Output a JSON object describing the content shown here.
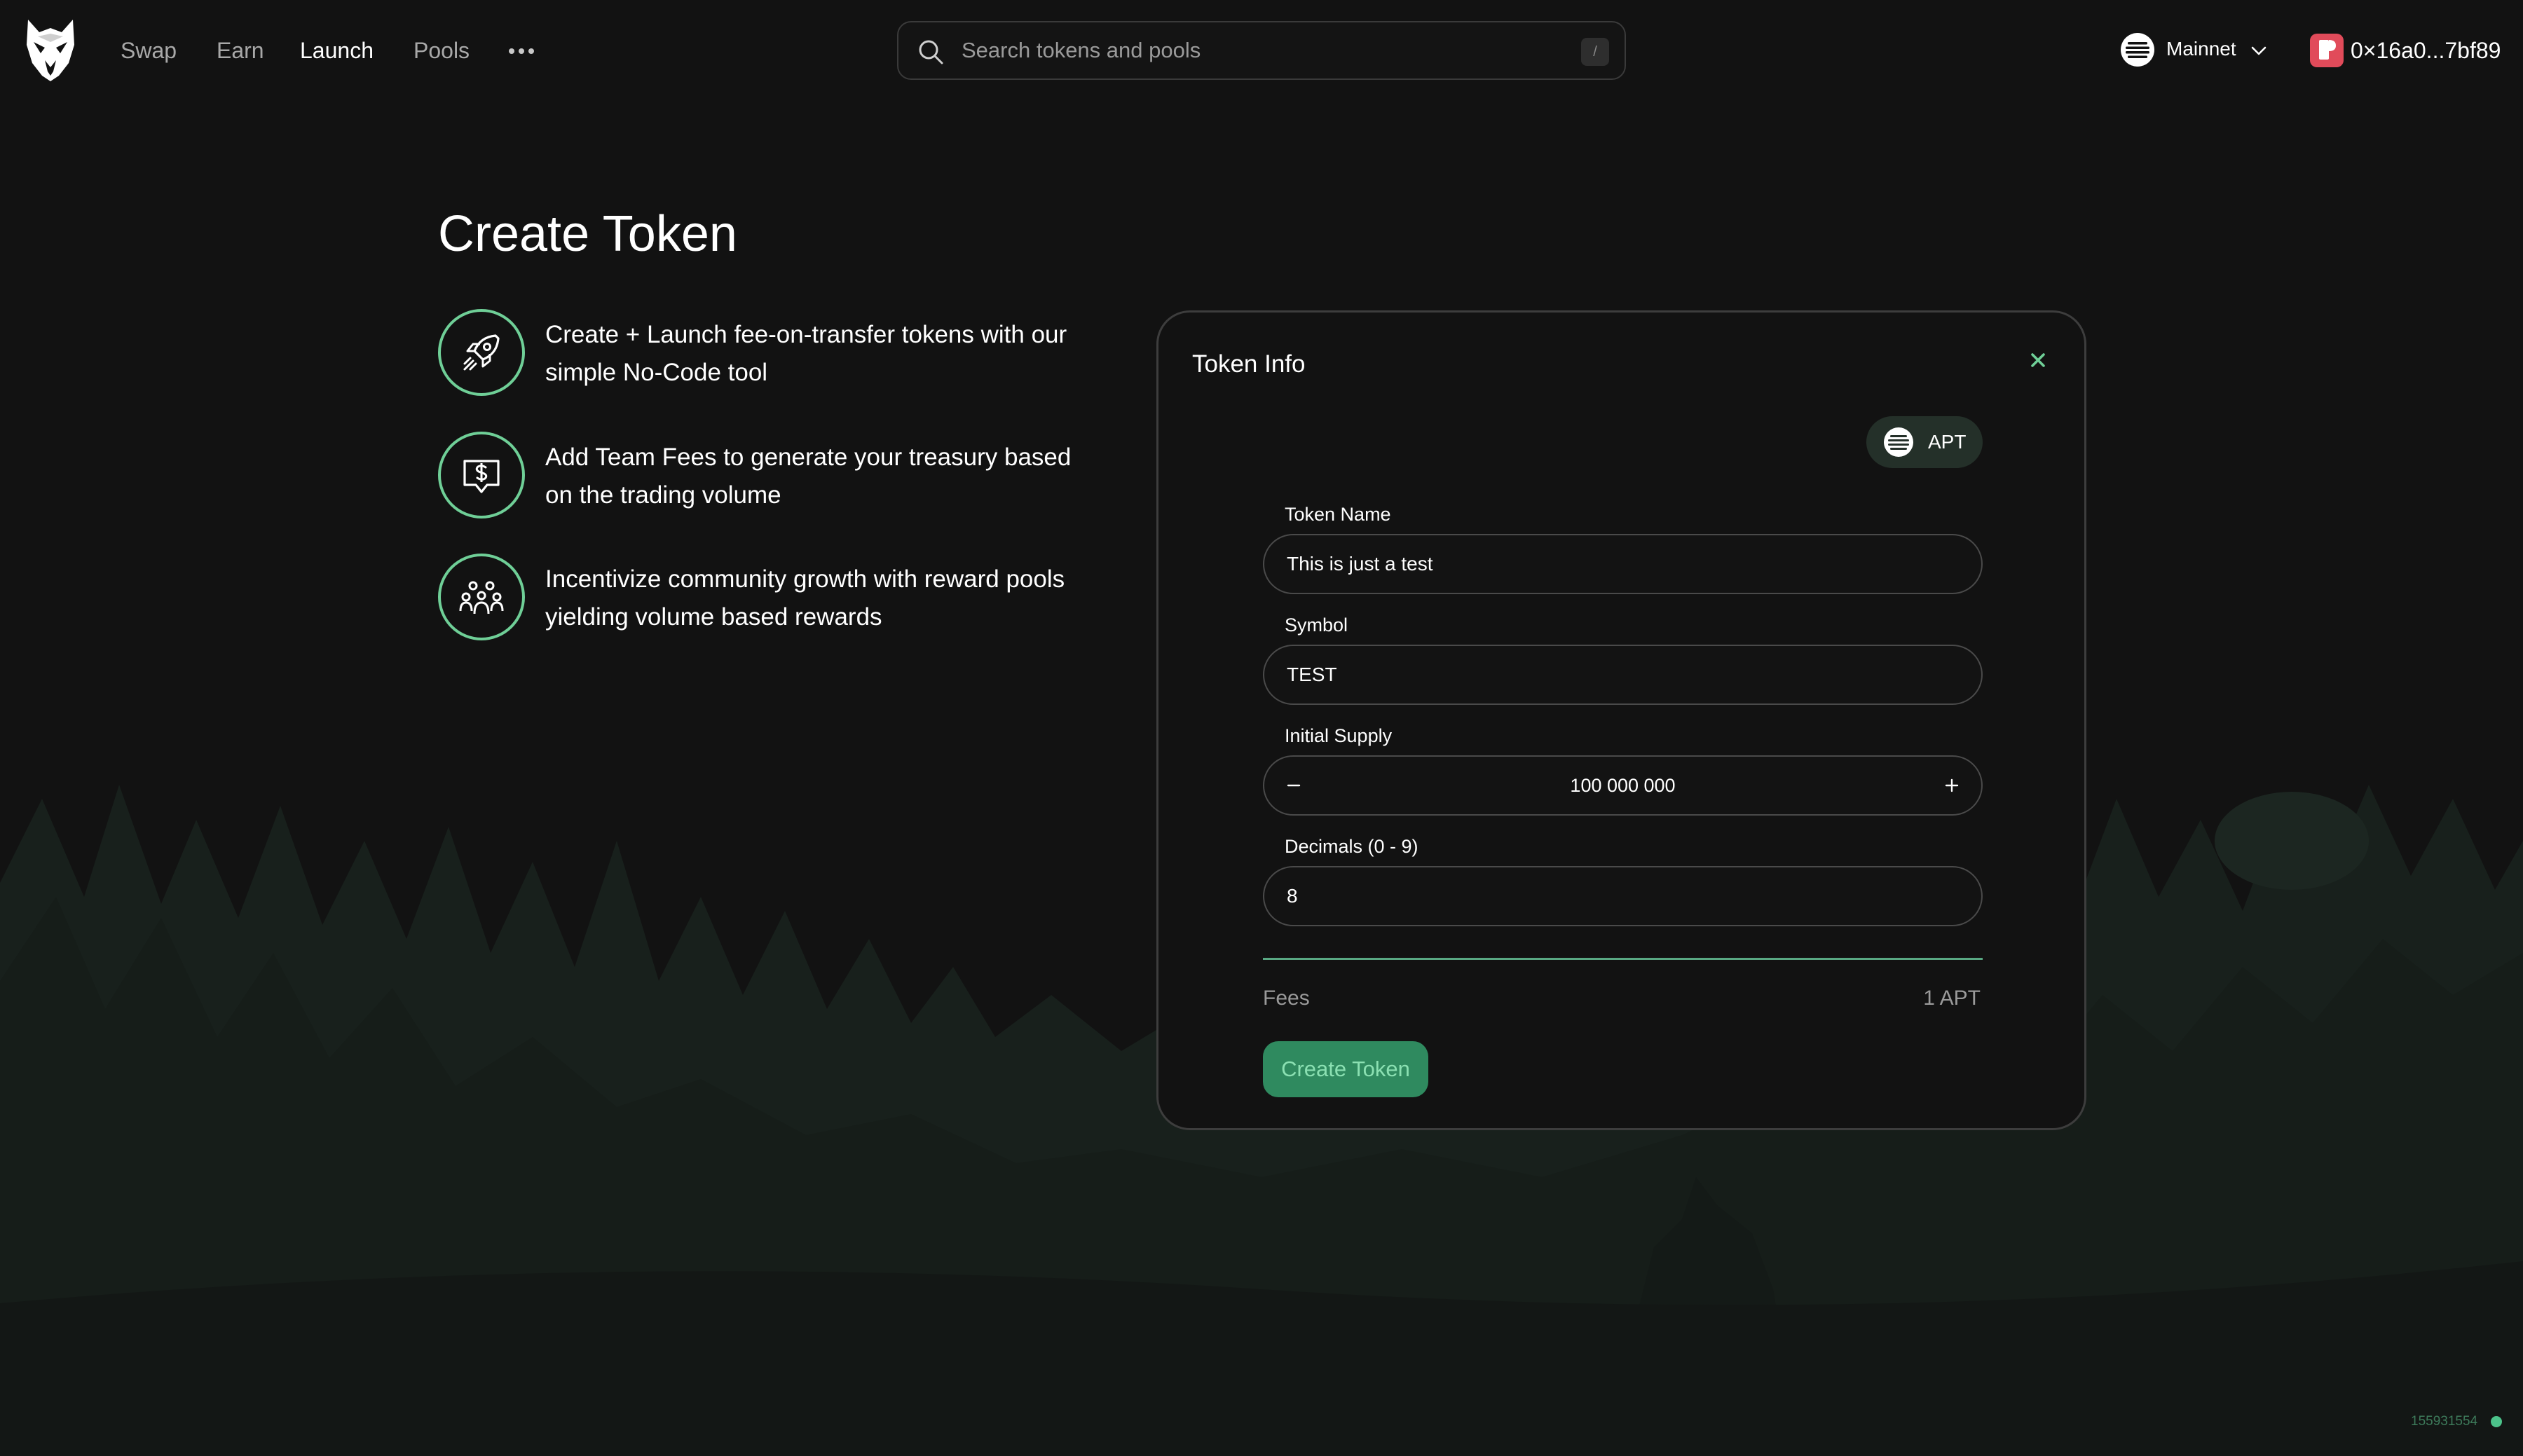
{
  "nav": {
    "links": [
      {
        "label": "Swap",
        "active": false
      },
      {
        "label": "Earn",
        "active": false
      },
      {
        "label": "Launch",
        "active": true
      },
      {
        "label": "Pools",
        "active": false
      }
    ],
    "more_icon": "more-horizontal-icon"
  },
  "search": {
    "placeholder": "Search tokens and pools",
    "shortcut": "/"
  },
  "network": {
    "label": "Mainnet",
    "icon": "aptos-icon"
  },
  "wallet": {
    "address": "0×16a0...7bf89",
    "icon": "petra-wallet-icon",
    "color": "#e14b5a"
  },
  "page": {
    "title": "Create Token",
    "features": [
      {
        "icon": "rocket-icon",
        "text": "Create + Launch fee-on-transfer tokens with our simple No-Code tool"
      },
      {
        "icon": "dollar-speech-icon",
        "text": "Add Team Fees to generate your treasury based on the trading volume"
      },
      {
        "icon": "community-icon",
        "text": "Incentivize community growth with reward pools yielding volume based rewards"
      }
    ]
  },
  "card": {
    "title": "Token Info",
    "currency_chip": "APT",
    "fields": {
      "token_name": {
        "label": "Token Name",
        "value": "This is just a test"
      },
      "symbol": {
        "label": "Symbol",
        "value": "TEST"
      },
      "initial_supply": {
        "label": "Initial Supply",
        "value": "100 000 000"
      },
      "decimals": {
        "label": "Decimals (0 - 9)",
        "value": "8"
      }
    },
    "fees": {
      "label": "Fees",
      "value": "1 APT"
    },
    "submit_label": "Create Token"
  },
  "footer": {
    "block_number": "155931554"
  },
  "colors": {
    "accent": "#6fcf97",
    "button_bg": "#2f8a5f",
    "background": "#121212"
  }
}
